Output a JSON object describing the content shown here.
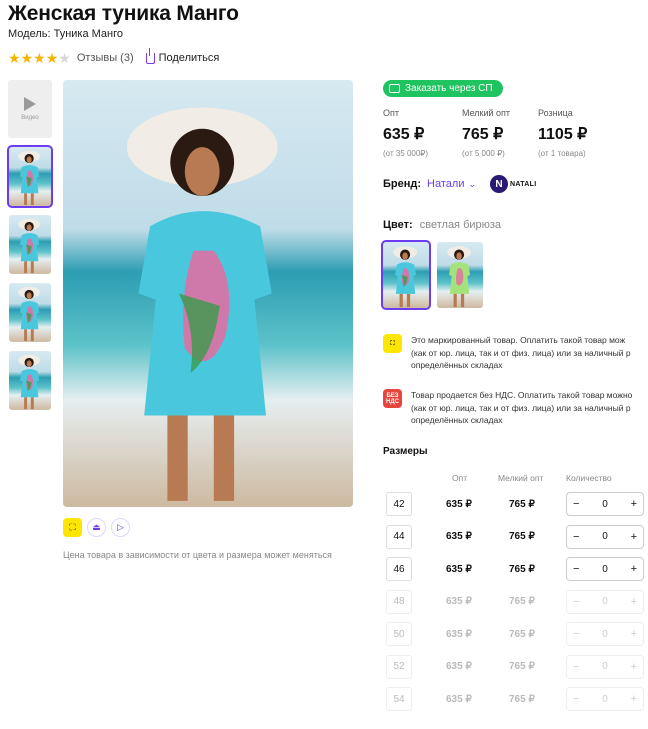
{
  "product": {
    "title": "Женская туника Манго",
    "model": "Модель: Туника Манго",
    "rating": 4,
    "reviews_label": "Отзывы (3)",
    "share_label": "Поделиться"
  },
  "gallery": {
    "video_label": "Видео",
    "price_note": "Цена товара в зависимости от цвета и размера может меняться"
  },
  "order_button": "Заказать через СП",
  "prices": [
    {
      "label": "Опт",
      "value": "635 ₽",
      "sub": "(от 35 000₽)"
    },
    {
      "label": "Мелкий опт",
      "value": "765 ₽",
      "sub": "(от 5 000 ₽)"
    },
    {
      "label": "Розница",
      "value": "1105 ₽",
      "sub": "(от 1 товара)"
    }
  ],
  "brand": {
    "label": "Бренд:",
    "name": "Натали",
    "logo_text": "NATALI",
    "logo_letter": "N"
  },
  "color": {
    "label": "Цвет:",
    "value": "светлая бирюза"
  },
  "info": {
    "marked": "Это маркированный товар. Оплатить такой товар мож\n(как от юр. лица, так и от физ. лица) или за наличный р\nопределённых складах",
    "vat_icon": "БЕЗ НДС",
    "vat": "Товар продается без НДС. Оплатить такой товар можно\n(как от юр. лица, так и от физ. лица) или за наличный р\nопределённых складах"
  },
  "sizes": {
    "title": "Размеры",
    "headers": {
      "opt": "Опт",
      "small": "Мелкий опт",
      "qty": "Количество"
    },
    "rows": [
      {
        "size": "42",
        "opt": "635 ₽",
        "small": "765 ₽",
        "qty": "0",
        "available": true
      },
      {
        "size": "44",
        "opt": "635 ₽",
        "small": "765 ₽",
        "qty": "0",
        "available": true
      },
      {
        "size": "46",
        "opt": "635 ₽",
        "small": "765 ₽",
        "qty": "0",
        "available": true
      },
      {
        "size": "48",
        "opt": "635 ₽",
        "small": "765 ₽",
        "qty": "0",
        "available": false
      },
      {
        "size": "50",
        "opt": "635 ₽",
        "small": "765 ₽",
        "qty": "0",
        "available": false
      },
      {
        "size": "52",
        "opt": "635 ₽",
        "small": "765 ₽",
        "qty": "0",
        "available": false
      },
      {
        "size": "54",
        "opt": "635 ₽",
        "small": "765 ₽",
        "qty": "0",
        "available": false
      }
    ]
  },
  "colors": {
    "accent": "#6c3cf0",
    "order_green": "#1fc35f",
    "star": "#f5b400",
    "mark_yellow": "#ffe600",
    "vat_red": "#e8453c"
  }
}
